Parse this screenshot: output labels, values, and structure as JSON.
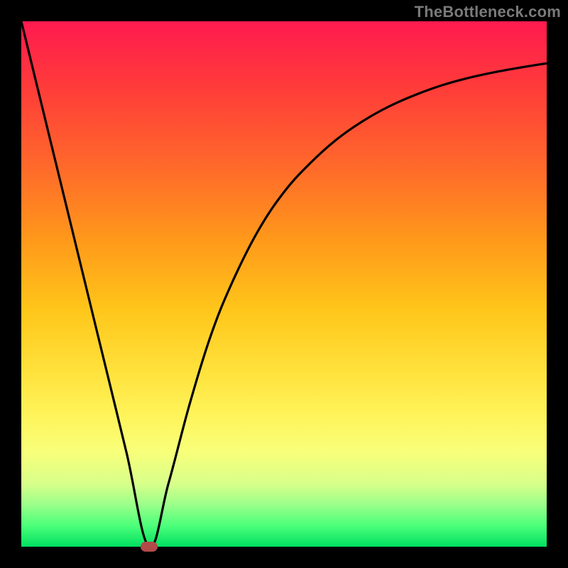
{
  "watermark": "TheBottleneck.com",
  "chart_data": {
    "type": "line",
    "title": "",
    "xlabel": "",
    "ylabel": "",
    "xlim": [
      0,
      100
    ],
    "ylim": [
      0,
      100
    ],
    "grid": false,
    "legend": false,
    "series": [
      {
        "name": "curve",
        "x": [
          0,
          5,
          10,
          15,
          20,
          24.3,
          28,
          32,
          36,
          40,
          45,
          50,
          55,
          60,
          65,
          70,
          75,
          80,
          85,
          90,
          95,
          100
        ],
        "y": [
          100,
          79.5,
          59,
          38.5,
          18,
          0,
          12,
          27,
          40,
          50,
          60,
          67.5,
          73,
          77.5,
          81,
          83.8,
          86,
          87.8,
          89.2,
          90.3,
          91.2,
          92
        ]
      }
    ],
    "marker": {
      "x": 24.3,
      "y": 0
    }
  },
  "colors": {
    "curve_stroke": "#000000",
    "marker_fill": "#b24a4a",
    "background_black": "#000000"
  }
}
